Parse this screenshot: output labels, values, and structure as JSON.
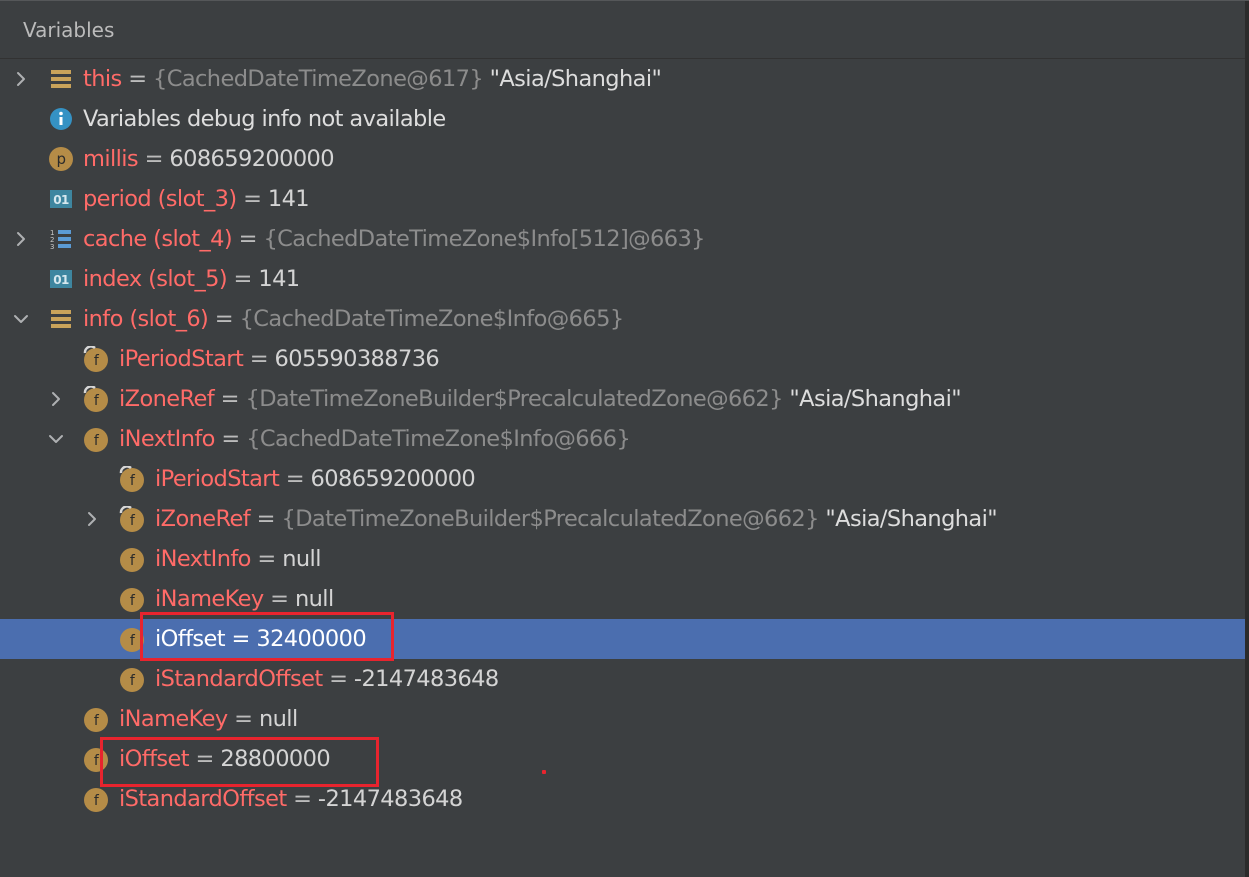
{
  "panel": {
    "title": "Variables"
  },
  "colors": {
    "background": "#3c3f41",
    "selection": "#4b6eaf",
    "name": "#ff6b68",
    "type": "#8c8c8c",
    "highlight_box": "#e8242e"
  },
  "rows": [
    {
      "name": "this",
      "eq": " = ",
      "type": "{CachedDateTimeZone@617}",
      "value": " \"Asia/Shanghai\"",
      "icon": "object-icon",
      "expand": "collapsed"
    },
    {
      "info": "Variables debug info not available",
      "icon": "info-icon"
    },
    {
      "name": "millis",
      "eq": " = ",
      "value": "608659200000",
      "icon": "parameter-icon"
    },
    {
      "name": "period (slot_3)",
      "eq": " = ",
      "value": "141",
      "icon": "primitive-icon"
    },
    {
      "name": "cache (slot_4)",
      "eq": " = ",
      "type": "{CachedDateTimeZone$Info[512]@663}",
      "icon": "array-icon",
      "expand": "collapsed"
    },
    {
      "name": "index (slot_5)",
      "eq": " = ",
      "value": "141",
      "icon": "primitive-icon"
    },
    {
      "name": "info (slot_6)",
      "eq": " = ",
      "type": "{CachedDateTimeZone$Info@665}",
      "icon": "object-icon",
      "expand": "expanded"
    },
    {
      "name": "iPeriodStart",
      "eq": " = ",
      "value": "605590388736",
      "icon": "final-field-icon"
    },
    {
      "name": "iZoneRef",
      "eq": " = ",
      "type": "{DateTimeZoneBuilder$PrecalculatedZone@662}",
      "value": " \"Asia/Shanghai\"",
      "icon": "final-field-icon",
      "expand": "collapsed"
    },
    {
      "name": "iNextInfo",
      "eq": " = ",
      "type": "{CachedDateTimeZone$Info@666}",
      "icon": "field-icon",
      "expand": "expanded"
    },
    {
      "name": "iPeriodStart",
      "eq": " = ",
      "value": "608659200000",
      "icon": "final-field-icon"
    },
    {
      "name": "iZoneRef",
      "eq": " = ",
      "type": "{DateTimeZoneBuilder$PrecalculatedZone@662}",
      "value": " \"Asia/Shanghai\"",
      "icon": "final-field-icon",
      "expand": "collapsed"
    },
    {
      "name": "iNextInfo",
      "eq": " = ",
      "value": "null",
      "icon": "field-icon"
    },
    {
      "name": "iNameKey",
      "eq": " = ",
      "value": "null",
      "icon": "field-icon"
    },
    {
      "name": "iOffset",
      "eq": " = ",
      "value": "32400000",
      "icon": "field-icon",
      "selected": true
    },
    {
      "name": "iStandardOffset",
      "eq": " = ",
      "value": "-2147483648",
      "icon": "field-icon"
    },
    {
      "name": "iNameKey",
      "eq": " = ",
      "value": "null",
      "icon": "field-icon"
    },
    {
      "name": "iOffset",
      "eq": " = ",
      "value": "28800000",
      "icon": "field-icon"
    },
    {
      "name": "iStandardOffset",
      "eq": " = ",
      "value": "-2147483648",
      "icon": "field-icon"
    }
  ]
}
